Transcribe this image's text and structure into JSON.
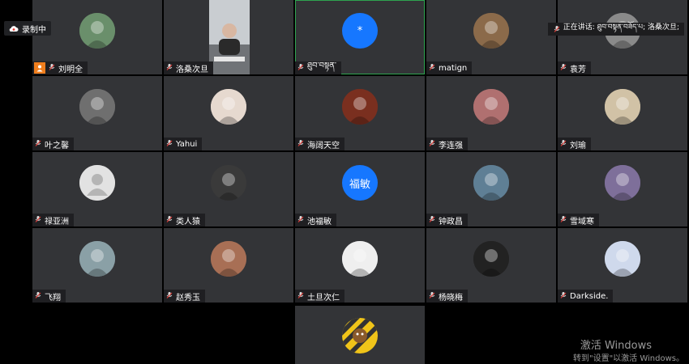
{
  "recording": {
    "label": "录制中"
  },
  "speaking": {
    "label": "正在讲话: ཐུབ་བསྟན་བཟོད་པ; 洛桑次旦;"
  },
  "watermark": {
    "line1": "激活 Windows",
    "line2": "转到\"设置\"以激活 Windows。"
  },
  "participants": [
    {
      "name": "刘明全",
      "avatar": "photo",
      "color": "#6a8f6b",
      "host": true
    },
    {
      "name": "洛桑次旦",
      "avatar": "video",
      "color": "#b7bcc0"
    },
    {
      "name": "ཐུབ་བསྟན་",
      "avatar": "text",
      "text": "*",
      "color": "#1677ff",
      "active": true
    },
    {
      "name": "matign",
      "avatar": "photo",
      "color": "#8b6a4a"
    },
    {
      "name": "袁芳",
      "avatar": "photo",
      "color": "#8a8a8a"
    },
    {
      "name": "叶之馨",
      "avatar": "photo",
      "color": "#6f6f6f"
    },
    {
      "name": "Yahui",
      "avatar": "photo",
      "color": "#e6d9cf"
    },
    {
      "name": "海阔天空",
      "avatar": "photo",
      "color": "#7a2f1f"
    },
    {
      "name": "李连强",
      "avatar": "photo",
      "color": "#b07070"
    },
    {
      "name": "刘瑜",
      "avatar": "photo",
      "color": "#d1c2a6"
    },
    {
      "name": "禄亚洲",
      "avatar": "default",
      "color": "#d9d9d9"
    },
    {
      "name": "类人猿",
      "avatar": "photo",
      "color": "#3a3a3a"
    },
    {
      "name": "池福敏",
      "avatar": "text",
      "text": "福敏",
      "color": "#1677ff"
    },
    {
      "name": "钟政昌",
      "avatar": "photo",
      "color": "#5f7f95"
    },
    {
      "name": "雪域寒",
      "avatar": "photo",
      "color": "#7e6f9a"
    },
    {
      "name": "飞翔",
      "avatar": "photo",
      "color": "#8aa0a6"
    },
    {
      "name": "赵秀玉",
      "avatar": "photo",
      "color": "#a86f55"
    },
    {
      "name": "土旦次仁",
      "avatar": "photo",
      "color": "#efefef"
    },
    {
      "name": "杨晓梅",
      "avatar": "photo",
      "color": "#222222"
    },
    {
      "name": "Darkside.",
      "avatar": "photo",
      "color": "#cfd9ec"
    }
  ],
  "extra_participant": {
    "avatar": "photo",
    "color": "#f0c419"
  }
}
